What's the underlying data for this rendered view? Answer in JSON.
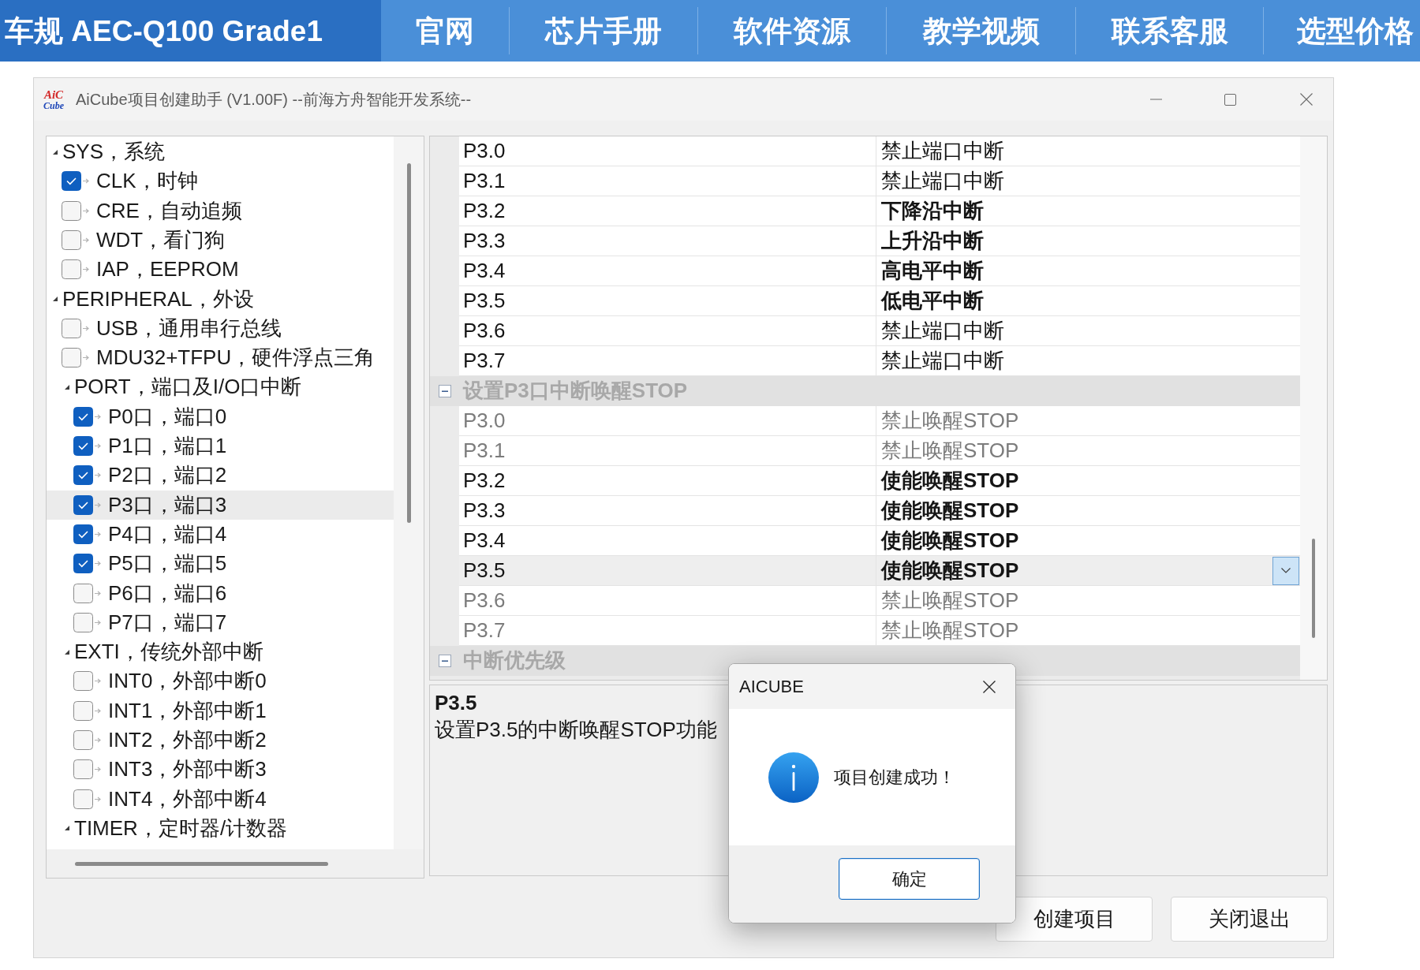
{
  "banner": {
    "title": "车规 AEC-Q100 Grade1",
    "nav": [
      {
        "label": "官网"
      },
      {
        "label": "芯片手册"
      },
      {
        "label": "软件资源"
      },
      {
        "label": "教学视频"
      },
      {
        "label": "联系客服"
      },
      {
        "label": "选型价格"
      }
    ]
  },
  "window": {
    "logo": {
      "top": "AiC",
      "bottom": "Cube"
    },
    "title": "AiCube项目创建助手 (V1.00F) --前海方舟智能开发系统--"
  },
  "tree": {
    "items": [
      {
        "kind": "group",
        "label": "SYS，系统",
        "expanded": true,
        "selected": false,
        "children": [
          {
            "kind": "check",
            "label": "CLK，时钟",
            "checked": true,
            "selected": false
          },
          {
            "kind": "check",
            "label": "CRE，自动追频",
            "checked": false,
            "selected": false
          },
          {
            "kind": "check",
            "label": "WDT，看门狗",
            "checked": false,
            "selected": false
          },
          {
            "kind": "check",
            "label": "IAP，EEPROM",
            "checked": false,
            "selected": false
          }
        ]
      },
      {
        "kind": "group",
        "label": "PERIPHERAL，外设",
        "expanded": true,
        "selected": false,
        "children": [
          {
            "kind": "check",
            "label": "USB，通用串行总线",
            "checked": false,
            "selected": false
          },
          {
            "kind": "check",
            "label": "MDU32+TFPU，硬件浮点三角",
            "checked": false,
            "selected": false
          },
          {
            "kind": "group",
            "label": "PORT，端口及I/O口中断",
            "expanded": true,
            "selected": false,
            "children": [
              {
                "kind": "check",
                "label": "P0口，端口0",
                "checked": true,
                "selected": false
              },
              {
                "kind": "check",
                "label": "P1口，端口1",
                "checked": true,
                "selected": false
              },
              {
                "kind": "check",
                "label": "P2口，端口2",
                "checked": true,
                "selected": false
              },
              {
                "kind": "check",
                "label": "P3口，端口3",
                "checked": true,
                "selected": true
              },
              {
                "kind": "check",
                "label": "P4口，端口4",
                "checked": true,
                "selected": false
              },
              {
                "kind": "check",
                "label": "P5口，端口5",
                "checked": true,
                "selected": false
              },
              {
                "kind": "check",
                "label": "P6口，端口6",
                "checked": false,
                "selected": false
              },
              {
                "kind": "check",
                "label": "P7口，端口7",
                "checked": false,
                "selected": false
              }
            ]
          },
          {
            "kind": "group",
            "label": "EXTI，传统外部中断",
            "expanded": true,
            "selected": false,
            "children": [
              {
                "kind": "check",
                "label": "INT0，外部中断0",
                "checked": false,
                "selected": false
              },
              {
                "kind": "check",
                "label": "INT1，外部中断1",
                "checked": false,
                "selected": false
              },
              {
                "kind": "check",
                "label": "INT2，外部中断2",
                "checked": false,
                "selected": false
              },
              {
                "kind": "check",
                "label": "INT3，外部中断3",
                "checked": false,
                "selected": false
              },
              {
                "kind": "check",
                "label": "INT4，外部中断4",
                "checked": false,
                "selected": false
              }
            ]
          },
          {
            "kind": "group",
            "label": "TIMER，定时器/计数器",
            "expanded": true,
            "selected": false
          }
        ]
      }
    ]
  },
  "property_grid": {
    "groups": [
      {
        "rows": [
          {
            "name": "P3.0",
            "value": "禁止端口中断",
            "modified": false,
            "disabled": false,
            "selected": false
          },
          {
            "name": "P3.1",
            "value": "禁止端口中断",
            "modified": false,
            "disabled": false,
            "selected": false
          },
          {
            "name": "P3.2",
            "value": "下降沿中断",
            "modified": true,
            "disabled": false,
            "selected": false
          },
          {
            "name": "P3.3",
            "value": "上升沿中断",
            "modified": true,
            "disabled": false,
            "selected": false
          },
          {
            "name": "P3.4",
            "value": "高电平中断",
            "modified": true,
            "disabled": false,
            "selected": false
          },
          {
            "name": "P3.5",
            "value": "低电平中断",
            "modified": true,
            "disabled": false,
            "selected": false
          },
          {
            "name": "P3.6",
            "value": "禁止端口中断",
            "modified": false,
            "disabled": false,
            "selected": false
          },
          {
            "name": "P3.7",
            "value": "禁止端口中断",
            "modified": false,
            "disabled": false,
            "selected": false
          }
        ]
      },
      {
        "title": "设置P3口中断唤醒STOP",
        "expanded": true,
        "rows": [
          {
            "name": "P3.0",
            "value": "禁止唤醒STOP",
            "modified": false,
            "disabled": true,
            "selected": false
          },
          {
            "name": "P3.1",
            "value": "禁止唤醒STOP",
            "modified": false,
            "disabled": true,
            "selected": false
          },
          {
            "name": "P3.2",
            "value": "使能唤醒STOP",
            "modified": true,
            "disabled": false,
            "selected": false
          },
          {
            "name": "P3.3",
            "value": "使能唤醒STOP",
            "modified": true,
            "disabled": false,
            "selected": false
          },
          {
            "name": "P3.4",
            "value": "使能唤醒STOP",
            "modified": true,
            "disabled": false,
            "selected": false
          },
          {
            "name": "P3.5",
            "value": "使能唤醒STOP",
            "modified": true,
            "disabled": false,
            "selected": true
          },
          {
            "name": "P3.6",
            "value": "禁止唤醒STOP",
            "modified": false,
            "disabled": true,
            "selected": false
          },
          {
            "name": "P3.7",
            "value": "禁止唤醒STOP",
            "modified": false,
            "disabled": true,
            "selected": false
          }
        ]
      },
      {
        "title": "中断优先级",
        "expanded": true
      }
    ]
  },
  "description": {
    "title": "P3.5",
    "text": "设置P3.5的中断唤醒STOP功能"
  },
  "buttons": [
    {
      "label": "创建项目"
    },
    {
      "label": "关闭退出"
    }
  ],
  "dialog": {
    "title": "AICUBE",
    "message": "项目创建成功！",
    "buttons": [
      {
        "label": "确定",
        "default": true
      }
    ]
  }
}
